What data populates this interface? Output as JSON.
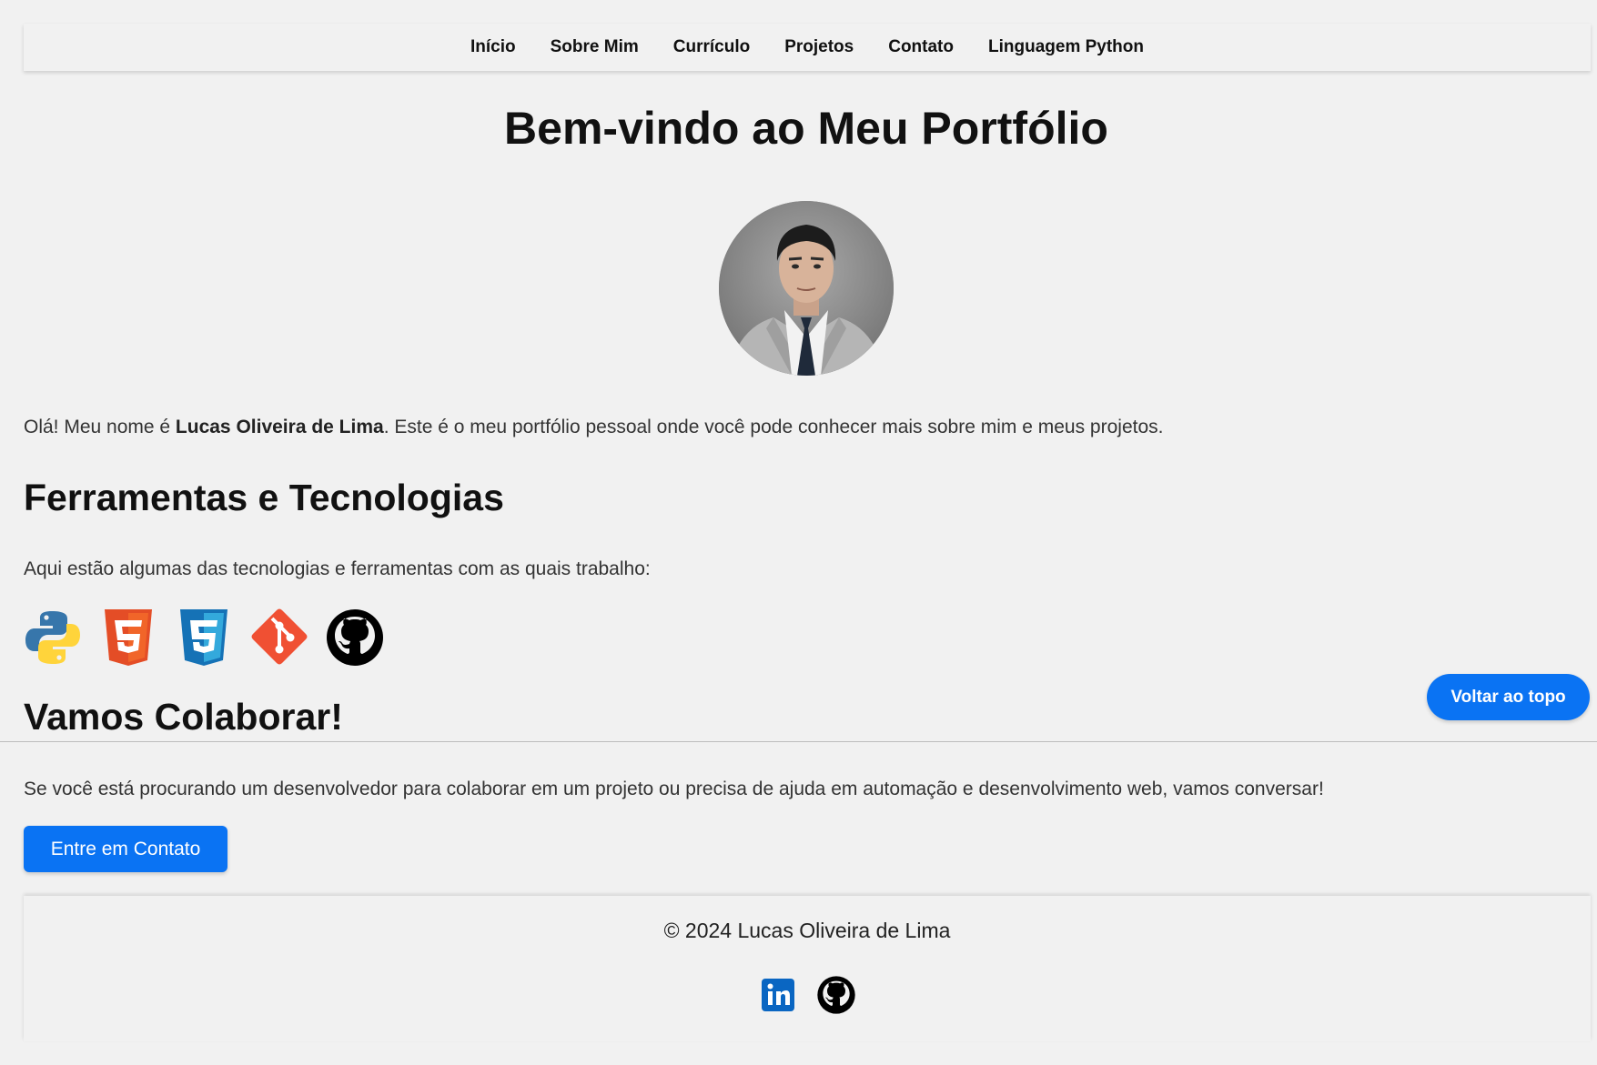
{
  "nav": {
    "items": [
      {
        "label": "Início"
      },
      {
        "label": "Sobre Mim"
      },
      {
        "label": "Currículo"
      },
      {
        "label": "Projetos"
      },
      {
        "label": "Contato"
      },
      {
        "label": "Linguagem Python"
      }
    ]
  },
  "header": {
    "title": "Bem-vindo ao Meu Portfólio"
  },
  "intro": {
    "prefix": "Olá! Meu nome é ",
    "name": "Lucas Oliveira de Lima",
    "suffix": ". Este é o meu portfólio pessoal onde você pode conhecer mais sobre mim e meus projetos."
  },
  "tools": {
    "title": "Ferramentas e Tecnologias",
    "description": "Aqui estão algumas das tecnologias e ferramentas com as quais trabalho:",
    "icons": [
      "python-icon",
      "html5-icon",
      "css3-icon",
      "git-icon",
      "github-icon"
    ]
  },
  "collab": {
    "title": "Vamos Colaborar!",
    "text": "Se você está procurando um desenvolvedor para colaborar em um projeto ou precisa de ajuda em automação e desenvolvimento web, vamos conversar!",
    "button_label": "Entre em Contato"
  },
  "back_to_top": {
    "label": "Voltar ao topo"
  },
  "footer": {
    "copyright": "© 2024 Lucas Oliveira de Lima",
    "social_icons": [
      "linkedin-icon",
      "github-icon"
    ]
  },
  "colors": {
    "accent": "#0a73f3",
    "background": "#f1f1f1",
    "text": "#333333",
    "python_blue": "#3776ab",
    "python_yellow": "#ffd43b",
    "html5": "#e44d26",
    "css3": "#1572b6",
    "git": "#f05033",
    "linkedin": "#0a66c2"
  }
}
